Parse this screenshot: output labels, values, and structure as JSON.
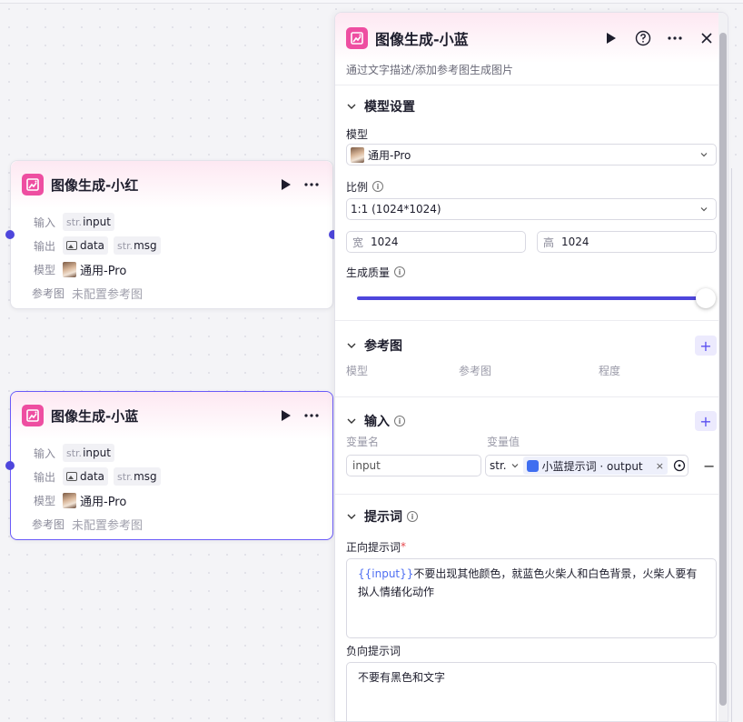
{
  "nodes": [
    {
      "title": "图像生成-小红",
      "input_label": "输入",
      "input_type": "str.",
      "input_name": "input",
      "output_label": "输出",
      "output_1": "data",
      "output_2_type": "str.",
      "output_2": "msg",
      "model_label": "模型",
      "model_value": "通用-Pro",
      "ref_label": "参考图",
      "ref_value": "未配置参考图"
    },
    {
      "title": "图像生成-小蓝",
      "input_label": "输入",
      "input_type": "str.",
      "input_name": "input",
      "output_label": "输出",
      "output_1": "data",
      "output_2_type": "str.",
      "output_2": "msg",
      "model_label": "模型",
      "model_value": "通用-Pro",
      "ref_label": "参考图",
      "ref_value": "未配置参考图"
    }
  ],
  "panel": {
    "title": "图像生成-小蓝",
    "description": "通过文字描述/添加参考图生成图片",
    "model_settings": {
      "title": "模型设置",
      "model_label": "模型",
      "model_value": "通用-Pro",
      "ratio_label": "比例",
      "ratio_value": "1:1 (1024*1024)",
      "width_prefix": "宽",
      "width_value": "1024",
      "height_prefix": "高",
      "height_value": "1024",
      "quality_label": "生成质量",
      "quality_fraction": 1.0
    },
    "reference": {
      "title": "参考图",
      "col_model": "模型",
      "col_ref": "参考图",
      "col_degree": "程度"
    },
    "inputs": {
      "title": "输入",
      "col_name": "变量名",
      "col_value": "变量值",
      "var_name": "input",
      "type_select": "str.",
      "ref_value": "小蓝提示词 · output",
      "remove_label": "−"
    },
    "prompt": {
      "title": "提示词",
      "positive_label": "正向提示词",
      "required_mark": "*",
      "positive_var": "{{input}}",
      "positive_text": "不要出现其他颜色，就蓝色火柴人和白色背景，火柴人要有拟人情绪化动作",
      "negative_label": "负向提示词",
      "negative_text": "不要有黑色和文字"
    }
  },
  "colors": {
    "accent": "#4e46dc",
    "node_icon": "#ee4ea1",
    "selected_border": "#6a5af9"
  }
}
